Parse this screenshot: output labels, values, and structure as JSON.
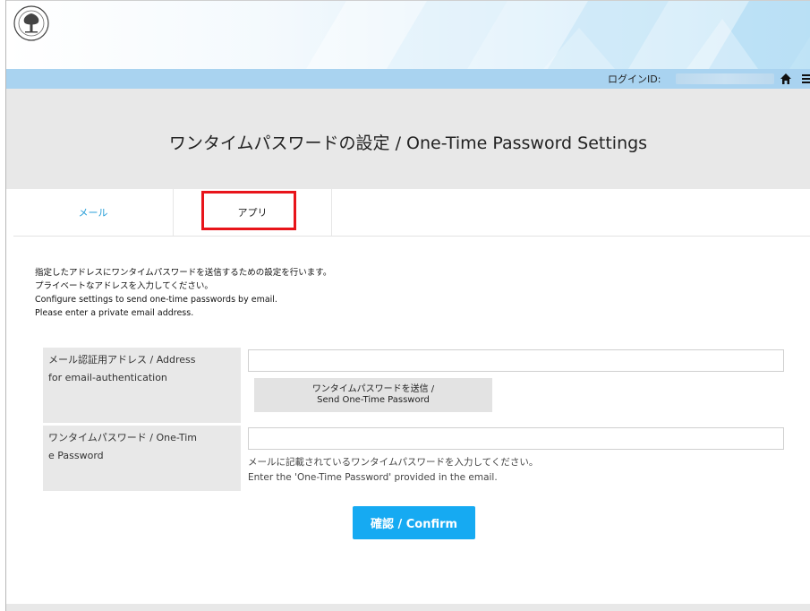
{
  "header": {
    "login_label": "ログインID:",
    "icons": {
      "logo": "university-seal-logo",
      "home": "home-icon",
      "menu": "hamburger-menu-icon"
    }
  },
  "page": {
    "title": "ワンタイムパスワードの設定 / One-Time Password Settings"
  },
  "tabs": [
    {
      "label": "メール",
      "active": false
    },
    {
      "label": "アプリ",
      "active": true
    }
  ],
  "intro": {
    "lines": [
      "指定したアドレスにワンタイムパスワードを送信するための設定を行います。",
      "プライベートなアドレスを入力してください。",
      "Configure settings to send one-time passwords by email.",
      "Please enter a private email address."
    ]
  },
  "form": {
    "address_label_line1": "メール認証用アドレス / Address",
    "address_label_line2": "for email-authentication",
    "address_value": "",
    "send_button_line1": "ワンタイムパスワードを送信 /",
    "send_button_line2": "Send One-Time Password",
    "otp_label_line1": "ワンタイムパスワード / One-Tim",
    "otp_label_line2": "e Password",
    "otp_value": "",
    "otp_hint_ja": "メールに記載されているワンタイムパスワードを入力してください。",
    "otp_hint_en": "Enter the 'One-Time Password' provided in the email.",
    "confirm_label": "確認 / Confirm"
  },
  "colors": {
    "accent_blue": "#16aaf2",
    "login_bar": "#a9d3f0",
    "tab_link": "#2a9fd8",
    "highlight_red": "#e8141a",
    "panel_gray": "#e8e8e8"
  }
}
